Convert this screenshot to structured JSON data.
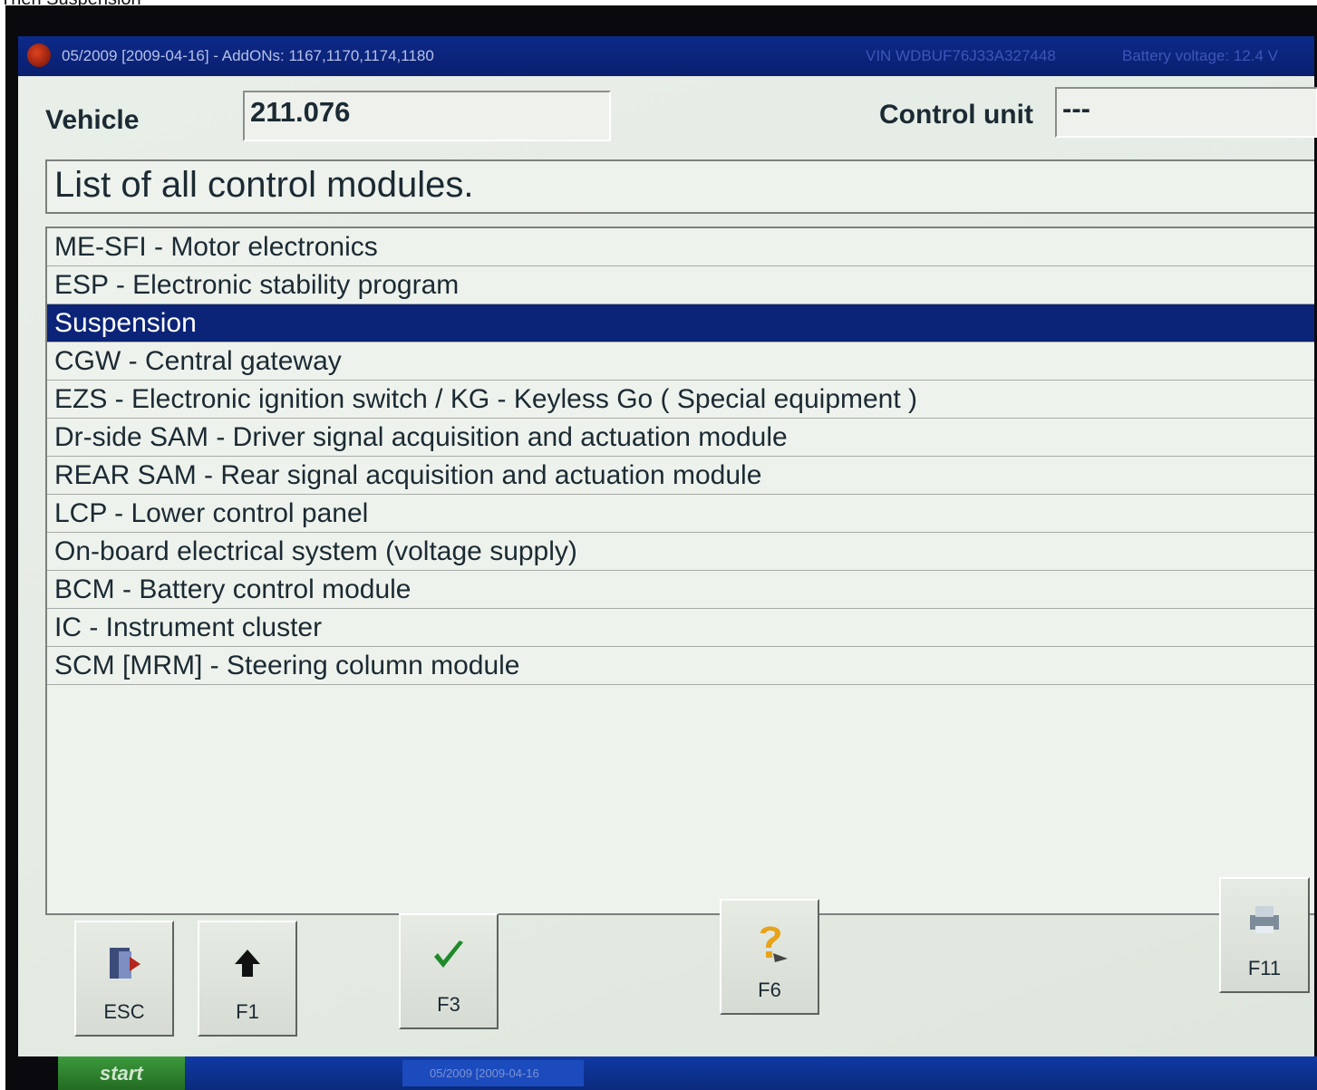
{
  "caption": "Then Suspension",
  "titlebar": {
    "left_text": "05/2009 [2009-04-16] - AddONs: 1167,1170,1174,1180",
    "vin_text": "VIN  WDBUF76J33A327448",
    "battery_text": "Battery voltage: 12.4 V"
  },
  "header": {
    "vehicle_label": "Vehicle",
    "vehicle_value": "211.076",
    "control_unit_label": "Control unit",
    "control_unit_value": "---"
  },
  "heading": "List of all control modules.",
  "modules": [
    "ME-SFI - Motor electronics",
    "ESP - Electronic stability program",
    "Suspension",
    "CGW - Central gateway",
    "EZS - Electronic ignition switch / KG - Keyless Go ( Special equipment )",
    "Dr-side SAM - Driver signal acquisition and actuation module",
    "REAR SAM - Rear signal acquisition and actuation module",
    "LCP - Lower control panel",
    "On-board electrical system (voltage supply)",
    "BCM - Battery control module",
    "IC - Instrument cluster",
    "SCM [MRM] - Steering column module"
  ],
  "selected_index": 2,
  "fkeys": {
    "esc": "ESC",
    "f1": "F1",
    "f3": "F3",
    "f6": "F6",
    "f11": "F11"
  },
  "taskbar": {
    "start_label": "start",
    "task_label": "05/2009 [2009-04-16"
  },
  "colors": {
    "selection": "#0b2477",
    "titlebar": "#0c2a8a",
    "background": "#e9eee8"
  }
}
